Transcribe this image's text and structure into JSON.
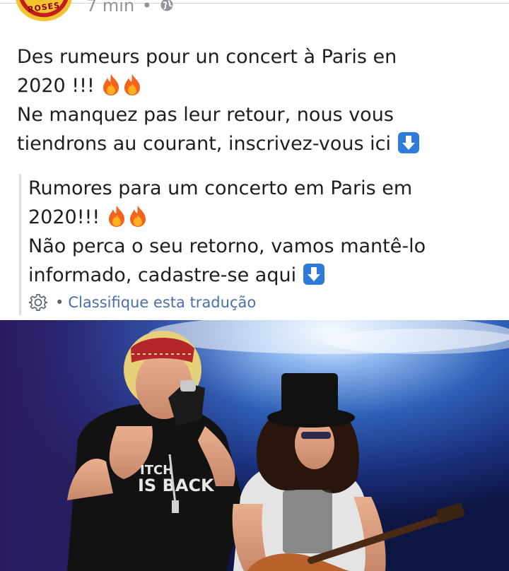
{
  "post": {
    "time": "7 min",
    "dot": "•",
    "avatar_text": "ROSES",
    "original": {
      "line1": "Des rumeurs pour un concert à Paris en",
      "line2": "2020 !!!",
      "line3": "Ne manquez pas leur retour, nous vous",
      "line4": "tiendrons au courant, inscrivez-vous ici"
    },
    "translation": {
      "line1": "Rumores para um concerto em Paris em",
      "line2": "2020!!!",
      "line3": "Não perca o seu retorno, vamos mantê-lo",
      "line4": "informado, cadastre-se aqui"
    },
    "rate": {
      "dot": "•",
      "label": "Classifique esta tradução"
    },
    "photo_text": {
      "shirt": "IS BACK",
      "shirt_top": "ITCH"
    }
  },
  "icons": {
    "globe": "globe-icon",
    "fire": "fire-emoji",
    "down_arrow": "down-arrow-emoji",
    "gear": "gear-icon"
  },
  "colors": {
    "meta_grey": "#90949c",
    "link_blue": "#4b6fa8",
    "emoji_blue": "#2f7bd9",
    "fire_orange": "#f4641c"
  }
}
